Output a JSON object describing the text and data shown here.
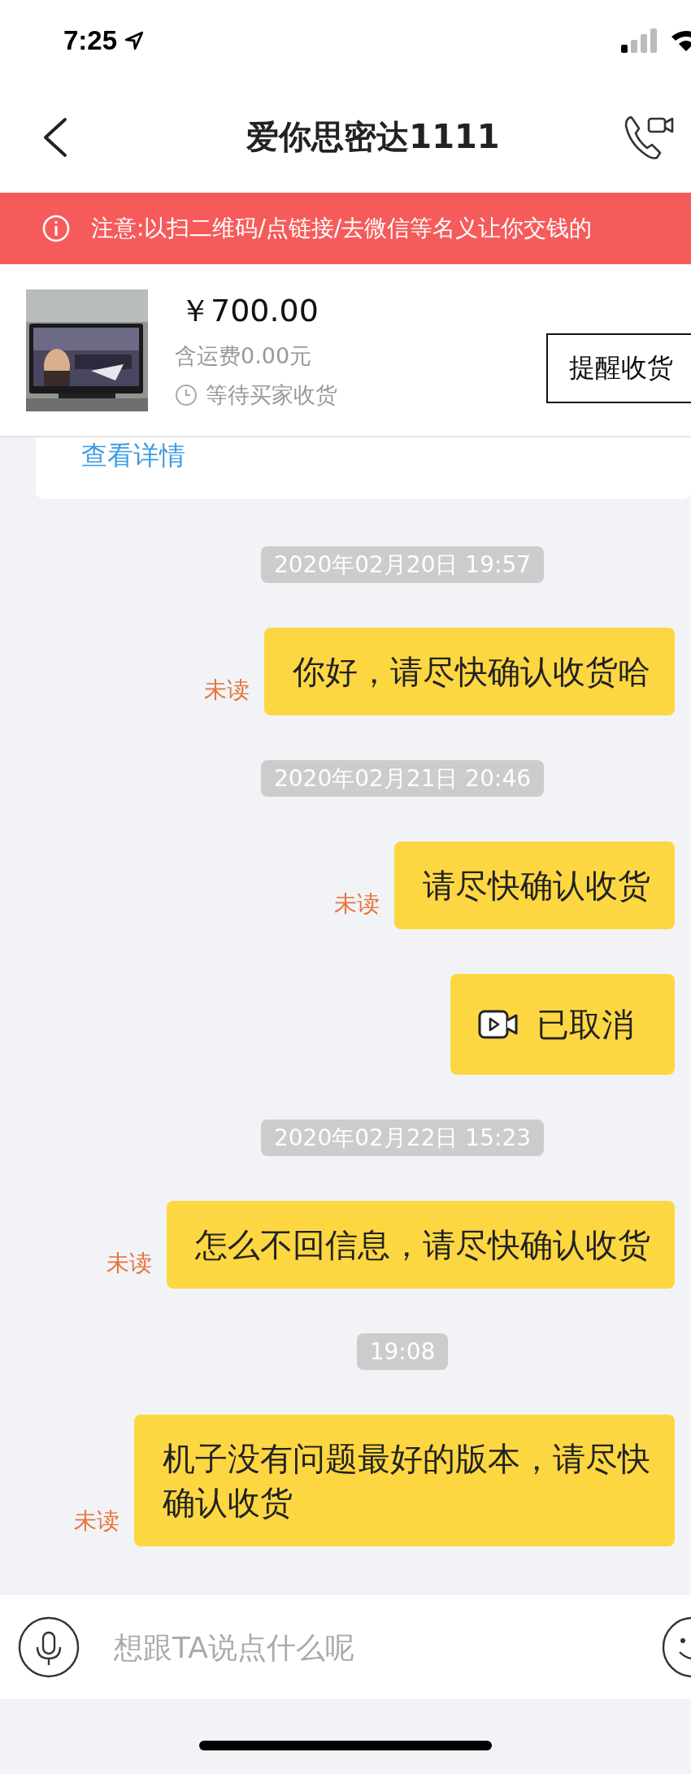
{
  "status_bar": {
    "time": "7:25"
  },
  "nav": {
    "title": "爱你思密达1111"
  },
  "notice": {
    "text": "注意:以扫二维码/点链接/去微信等名义让你交钱的"
  },
  "product": {
    "price": "￥700.00",
    "shipping": "含运费0.00元",
    "status": "等待买家收货",
    "button": "提醒收货"
  },
  "order_card": {
    "link": "查看详情"
  },
  "messages": [
    {
      "kind": "timestamp",
      "text": "2020年02月20日 19:57"
    },
    {
      "kind": "text",
      "text": "你好，请尽快确认收货哈",
      "status": "未读"
    },
    {
      "kind": "timestamp",
      "text": "2020年02月21日 20:46"
    },
    {
      "kind": "text",
      "text": "请尽快确认收货",
      "status": "未读"
    },
    {
      "kind": "video_call",
      "text": "已取消"
    },
    {
      "kind": "timestamp",
      "text": "2020年02月22日 15:23"
    },
    {
      "kind": "text",
      "text": "怎么不回信息，请尽快确认收货",
      "status": "未读"
    },
    {
      "kind": "timestamp",
      "text": "19:08"
    },
    {
      "kind": "text",
      "text": "机子没有问题最好的版本，请尽快确认收货",
      "status": "未读"
    }
  ],
  "input": {
    "placeholder": "想跟TA说点什么呢"
  }
}
